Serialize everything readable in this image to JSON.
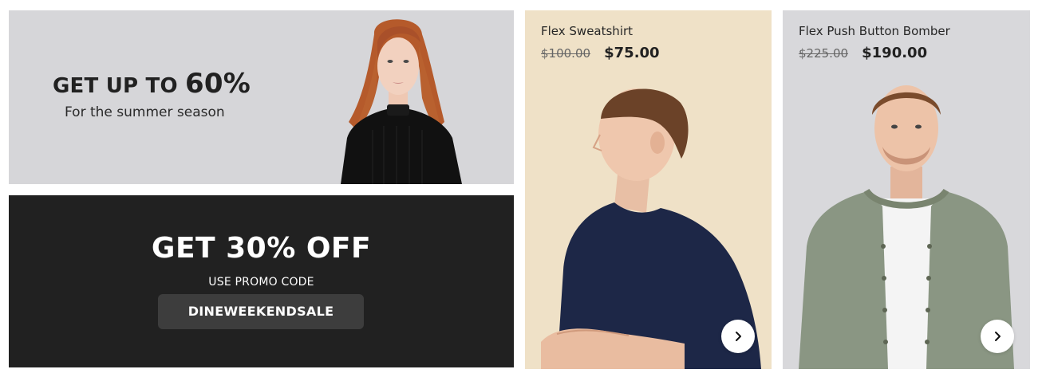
{
  "banners": {
    "summer": {
      "headline_lead": "GET UP TO ",
      "headline_value": "60%",
      "subtitle": "For the summer season",
      "background": "#d6d6d9"
    },
    "promo": {
      "title": "GET 30% OFF",
      "label": "USE PROMO CODE",
      "code": "DINEWEEKENDSALE",
      "background": "#212121"
    }
  },
  "products": [
    {
      "name": "Flex Sweatshirt",
      "old_price": "$100.00",
      "price": "$75.00",
      "background": "#efe1c7",
      "next_icon": "chevron-right-icon"
    },
    {
      "name": "Flex Push Button Bomber",
      "old_price": "$225.00",
      "price": "$190.00",
      "background": "#d8d8db",
      "next_icon": "chevron-right-icon"
    }
  ]
}
